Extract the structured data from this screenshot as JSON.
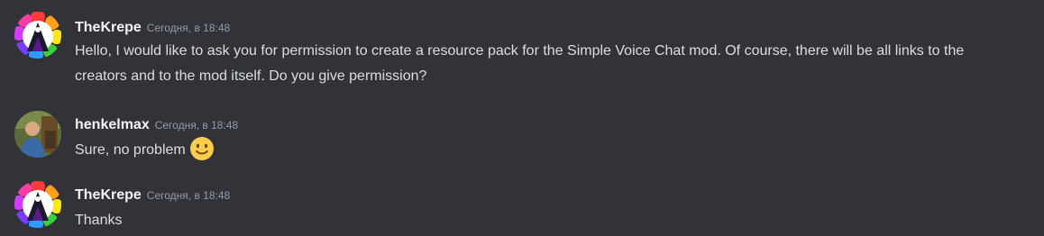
{
  "messages": [
    {
      "username": "TheKrepe",
      "timestamp": "Сегодня, в 18:48",
      "text": "Hello, I would like to ask you for permission to create a resource pack for the Simple Voice Chat mod. Of course, there will be all links to the creators and to the mod itself. Do you give permission?",
      "avatar_icon": "rainbow-flower-avatar"
    },
    {
      "username": "henkelmax",
      "timestamp": "Сегодня, в 18:48",
      "text": "Sure, no problem",
      "emoji": "slightly-smiling-face",
      "avatar_icon": "photo-avatar"
    },
    {
      "username": "TheKrepe",
      "timestamp": "Сегодня, в 18:48",
      "text": "Thanks",
      "avatar_icon": "rainbow-flower-avatar"
    }
  ],
  "colors": {
    "background": "#313338",
    "username": "#f2f3f5",
    "timestamp": "#949ba4",
    "text": "#dbdee1"
  }
}
